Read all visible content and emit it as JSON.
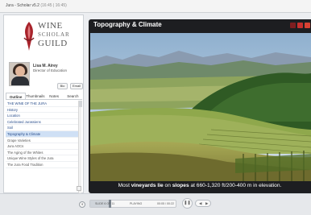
{
  "titlebar": {
    "title": "Jura - Scholar v5.2",
    "meta": "(16:45 | 16:45)"
  },
  "brand": {
    "line1": "WINE",
    "line2": "SCHOLAR",
    "line3": "GUILD"
  },
  "presenter": {
    "name": "Lisa M. Airey",
    "title": "Director of Education"
  },
  "sidebar": {
    "bio_label": "Bio",
    "email_label": "Email",
    "tabs": [
      {
        "label": "Outline"
      },
      {
        "label": "Thumbnails"
      },
      {
        "label": "Notes"
      },
      {
        "label": "Search"
      }
    ],
    "items": [
      {
        "label": "THE WINE OF THE JURA"
      },
      {
        "label": "History"
      },
      {
        "label": "Location"
      },
      {
        "label": "Celebrated Jurassiens"
      },
      {
        "label": "Soil"
      },
      {
        "label": "Topography & Climate"
      },
      {
        "label": "Grape Varieties"
      },
      {
        "label": "Jura AOCs"
      },
      {
        "label": "The Aging of the Whites"
      },
      {
        "label": "Unique Wine Styles of the Jura"
      },
      {
        "label": "The Jura Food Tradition"
      }
    ]
  },
  "slide": {
    "title": "Topography & Climate",
    "caption_parts": {
      "a": "Most ",
      "b": "vineyards lie",
      "c": " on ",
      "d": "slopes",
      "e": " at 660-1,320 ft/200-400 m in elevation."
    }
  },
  "player": {
    "slide_counter": "SLIDE 6 OF 11",
    "state": "PLAYING",
    "time": "00:05 / 00:22",
    "progress": 0.23
  },
  "colors": {
    "accent_red": "#c7302e",
    "selected": "#cfe0f5",
    "link": "#2a4e8c"
  }
}
